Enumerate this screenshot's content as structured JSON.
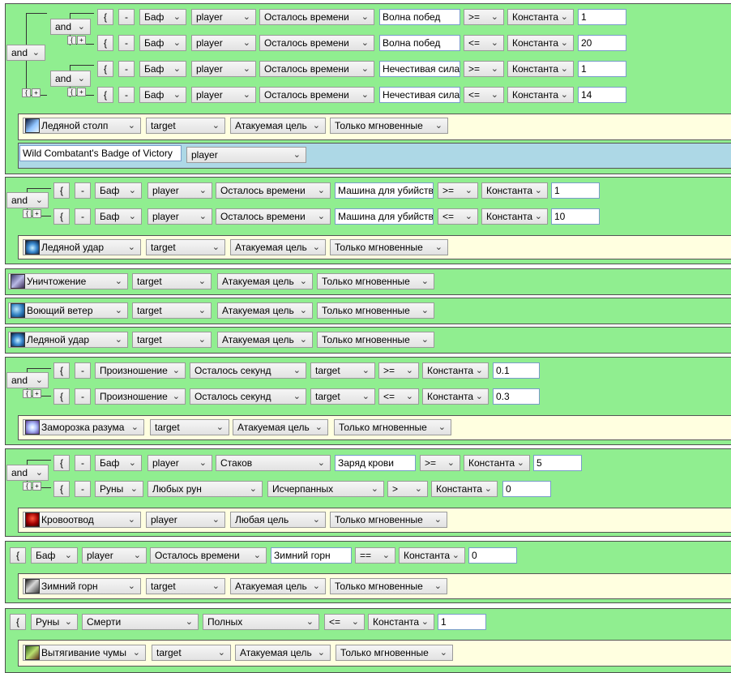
{
  "labels": {
    "and": "and",
    "open_brace": "{",
    "minus": "-",
    "bracket_small": "{",
    "plus_small": "+"
  },
  "values": {
    "buff": "Баф",
    "player": "player",
    "target": "target",
    "time_left": "Осталось времени",
    "seconds_left": "Осталось секунд",
    "stacks": "Стаков",
    "cast": "Произношение",
    "runes": "Руны",
    "any_runes": "Любых рун",
    "depleted": "Исчерпанных",
    "death": "Смерти",
    "full": "Полных",
    "constant": "Константа",
    "ge": ">=",
    "le": "<=",
    "gt": ">",
    "eq": "==",
    "attacked_target": "Атакуемая цель",
    "any_target": "Любая цель",
    "instant_only": "Только мгновенные"
  },
  "text": {
    "wave_of_victory": "Волна побед",
    "unholy_strength": "Нечестивая сила",
    "killing_machine": "Машина для убийств",
    "blood_charge": "Заряд крови",
    "winter_horn": "Зимний горн",
    "badge": "Wild Combatant's Badge of Victory"
  },
  "nums": {
    "n1": "1",
    "n20": "20",
    "n14": "14",
    "n10": "10",
    "n01": "0.1",
    "n03": "0.3",
    "n5": "5",
    "n0": "0"
  },
  "spells": {
    "ice_pillar": "Ледяной столп",
    "frost_strike": "Ледяной удар",
    "obliterate": "Уничтожение",
    "howling_wind": "Воющий ветер",
    "mind_freeze": "Заморозка разума",
    "blood_tap": "Кровоотвод",
    "horn_of_winter": "Зимний горн",
    "plague_strike": "Вытягивание чумы"
  },
  "icons": {
    "frost": "ice-pillar-icon",
    "frost_strike": "frost-strike-icon",
    "obliterate": "obliterate-icon",
    "wind": "howling-wind-icon",
    "mind": "mind-freeze-icon",
    "blood": "blood-tap-icon",
    "horn": "horn-of-winter-icon",
    "plague": "plague-strike-icon"
  }
}
